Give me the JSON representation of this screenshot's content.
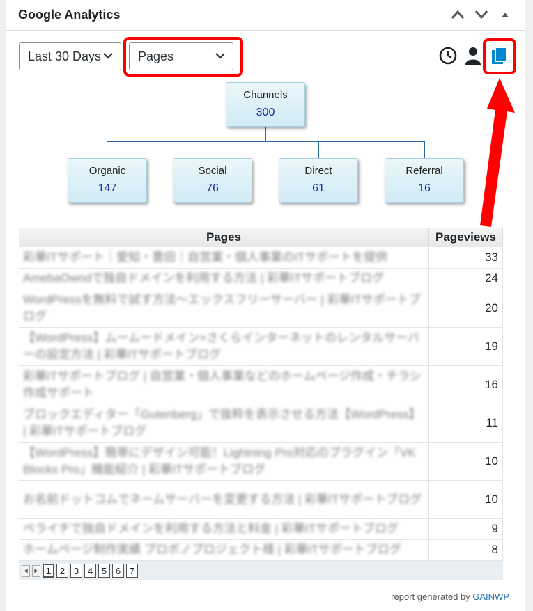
{
  "widget": {
    "title": "Google Analytics"
  },
  "controls": {
    "period": "Last 30 Days",
    "report": "Pages"
  },
  "tree": {
    "root": {
      "label": "Channels",
      "value": "300"
    },
    "children": [
      {
        "label": "Organic",
        "value": "147"
      },
      {
        "label": "Social",
        "value": "76"
      },
      {
        "label": "Direct",
        "value": "61"
      },
      {
        "label": "Referral",
        "value": "16"
      }
    ]
  },
  "table": {
    "headers": {
      "pages": "Pages",
      "pageviews": "Pageviews"
    },
    "rows": [
      {
        "page": "彩華ITサポート｜愛知・豊田｜自営業・個人事業のITサポートを提供",
        "views": "33"
      },
      {
        "page": "AmebaOwndで独自ドメインを利用する方法 | 彩華ITサポートブログ",
        "views": "24"
      },
      {
        "page": "WordPressを無料で試す方法〜エックスフリーサーバー | 彩華ITサポートブログ",
        "views": "20"
      },
      {
        "page": "【WordPress】ムームードメイン+さくらインターネットのレンタルサーバーの設定方法 | 彩華ITサポートブログ",
        "views": "19"
      },
      {
        "page": "彩華ITサポートブログ | 自営業・個人事業などのホームページ作成・チラシ作成サポート",
        "views": "16"
      },
      {
        "page": "ブロックエディター「Gutenberg」で抜粋を表示させる方法【WordPress】 | 彩華ITサポートブログ",
        "views": "11"
      },
      {
        "page": "【WordPress】簡単にデザイン可能！Lightning Pro対応のプラグイン「VK Blocks Pro」機能紹介 | 彩華ITサポートブログ",
        "views": "10"
      },
      {
        "page": "お名前ドットコムでネームサーバーを変更する方法 | 彩華ITサポートブログ",
        "views": "10"
      },
      {
        "page": "ペライチで独自ドメインを利用する方法と料金 | 彩華ITサポートブログ",
        "views": "9"
      },
      {
        "page": "ホームページ制作実績 プロボノプロジェクト様 | 彩華ITサポートブログ",
        "views": "8"
      }
    ]
  },
  "pager": {
    "pages": [
      "1",
      "2",
      "3",
      "4",
      "5",
      "6",
      "7"
    ],
    "current": "1"
  },
  "footer": {
    "text": "report generated by",
    "link": "GAINWP"
  },
  "colors": {
    "annotation_red": "#ff0000",
    "accent_blue": "#0088cc",
    "link_blue": "#2271b1"
  },
  "icons": {
    "header": [
      "chevron-up-icon",
      "chevron-down-icon",
      "triangle-up-icon"
    ],
    "tools": [
      "clock-icon",
      "user-icon",
      "pages-icon"
    ]
  }
}
